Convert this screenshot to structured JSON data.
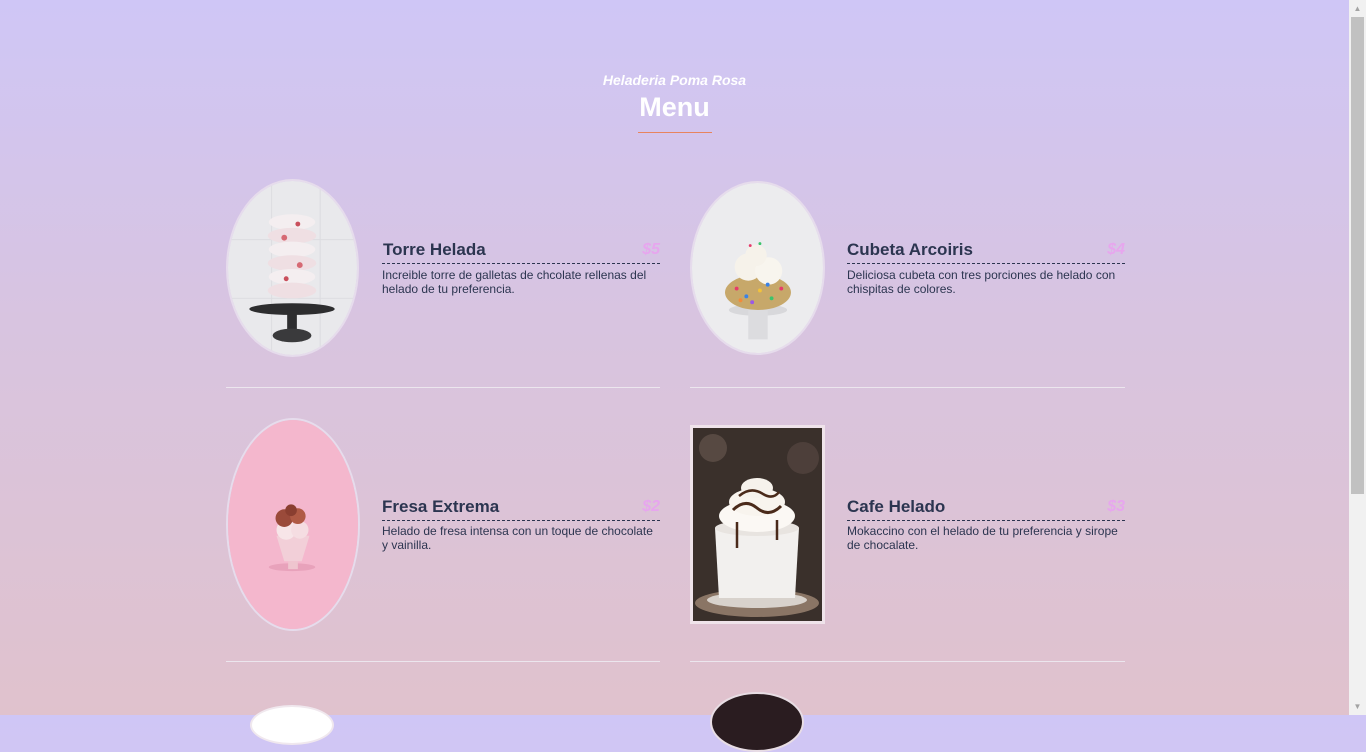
{
  "header": {
    "subtitle": "Heladeria Poma Rosa",
    "title": "Menu"
  },
  "menu": {
    "items": [
      {
        "name": "Torre Helada",
        "price": "$5",
        "description": "Increible torre de galletas de chcolate rellenas del helado de tu preferencia.",
        "image_icon": "cookie-tower-photo"
      },
      {
        "name": "Cubeta Arcoiris",
        "price": "$4",
        "description": "Deliciosa cubeta con tres porciones de helado con chispitas de colores.",
        "image_icon": "sprinkle-ice-cream-photo"
      },
      {
        "name": "Fresa Extrema",
        "price": "$2",
        "description": "Helado de fresa intensa con un toque de chocolate y vainilla.",
        "image_icon": "strawberry-sundae-photo"
      },
      {
        "name": "Cafe Helado",
        "price": "$3",
        "description": "Mokaccino con el helado de tu preferencia y sirope de chocalate.",
        "image_icon": "iced-coffee-photo"
      }
    ]
  },
  "colors": {
    "background_top": "#cfc6f6",
    "background_bottom": "#e0c2cd",
    "heading_text": "#ffffff",
    "accent_underline": "#e8845e",
    "item_text": "#2c3550",
    "price": "#e7a6ee"
  }
}
